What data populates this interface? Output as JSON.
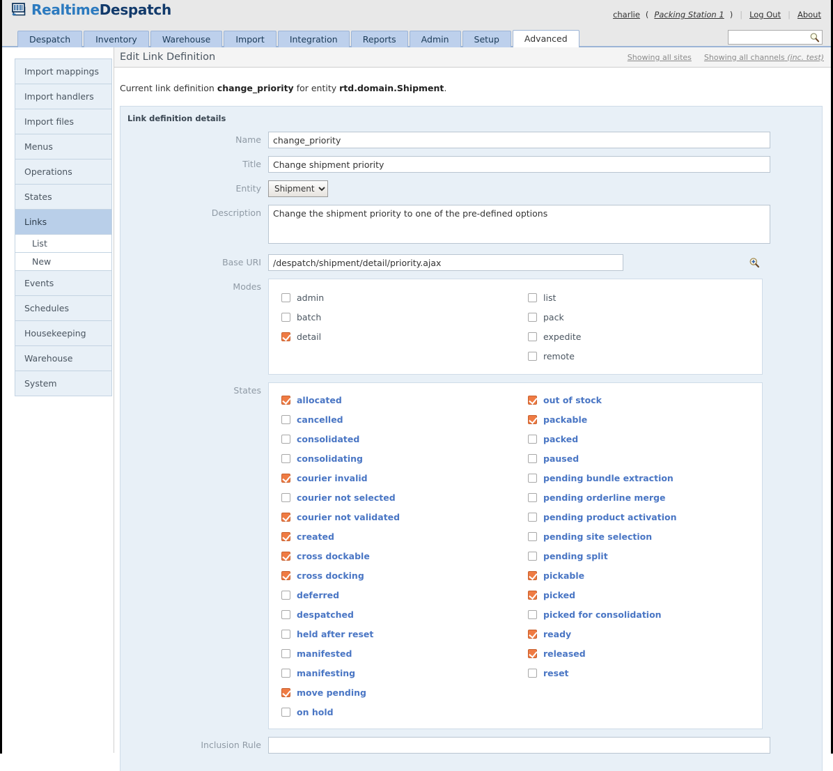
{
  "brand": {
    "part1": "Realtime",
    "part2": "Despatch",
    "logo_icon": "barcode-monitor-icon"
  },
  "header": {
    "user": "charlie",
    "station": "Packing Station 1",
    "logout": "Log Out",
    "about": "About",
    "search_placeholder": "",
    "search_value": "",
    "search_icon": "search-icon"
  },
  "tabs": [
    {
      "label": "Despatch",
      "active": false
    },
    {
      "label": "Inventory",
      "active": false
    },
    {
      "label": "Warehouse",
      "active": false
    },
    {
      "label": "Import",
      "active": false
    },
    {
      "label": "Integration",
      "active": false
    },
    {
      "label": "Reports",
      "active": false
    },
    {
      "label": "Admin",
      "active": false
    },
    {
      "label": "Setup",
      "active": false
    },
    {
      "label": "Advanced",
      "active": true
    }
  ],
  "sidebar": {
    "items": [
      {
        "label": "Import mappings",
        "active": false,
        "sub": false
      },
      {
        "label": "Import handlers",
        "active": false,
        "sub": false
      },
      {
        "label": "Import files",
        "active": false,
        "sub": false
      },
      {
        "label": "Menus",
        "active": false,
        "sub": false
      },
      {
        "label": "Operations",
        "active": false,
        "sub": false
      },
      {
        "label": "States",
        "active": false,
        "sub": false
      },
      {
        "label": "Links",
        "active": true,
        "sub": false
      },
      {
        "label": "List",
        "active": false,
        "sub": true
      },
      {
        "label": "New",
        "active": false,
        "sub": true
      },
      {
        "label": "Events",
        "active": false,
        "sub": false
      },
      {
        "label": "Schedules",
        "active": false,
        "sub": false
      },
      {
        "label": "Housekeeping",
        "active": false,
        "sub": false
      },
      {
        "label": "Warehouse",
        "active": false,
        "sub": false
      },
      {
        "label": "System",
        "active": false,
        "sub": false
      }
    ]
  },
  "content": {
    "title": "Edit Link Definition",
    "showing_sites": "Showing all sites",
    "showing_channels": "Showing all channels",
    "showing_channels_note": "(inc. test)",
    "lead_pre": "Current link definition ",
    "lead_name": "change_priority",
    "lead_mid": " for entity ",
    "lead_entity": "rtd.domain.Shipment",
    "lead_post": "."
  },
  "form": {
    "panel_title": "Link definition details",
    "labels": {
      "name": "Name",
      "title": "Title",
      "entity": "Entity",
      "description": "Description",
      "base_uri": "Base URI",
      "modes": "Modes",
      "states": "States",
      "inclusion_rule": "Inclusion Rule"
    },
    "values": {
      "name": "change_priority",
      "title": "Change shipment priority",
      "entity": "Shipment",
      "entity_options": [
        "Shipment"
      ],
      "description": "Change the shipment priority to one of the pre-defined options",
      "base_uri": "/despatch/shipment/detail/priority.ajax",
      "inclusion_rule": ""
    },
    "magnifier_icon": "zoom-in-icon",
    "modes": {
      "left": [
        {
          "label": "admin",
          "checked": false
        },
        {
          "label": "batch",
          "checked": false
        },
        {
          "label": "detail",
          "checked": true
        }
      ],
      "right": [
        {
          "label": "list",
          "checked": false
        },
        {
          "label": "pack",
          "checked": false
        },
        {
          "label": "expedite",
          "checked": false
        },
        {
          "label": "remote",
          "checked": false
        }
      ]
    },
    "states": {
      "left": [
        {
          "label": "allocated",
          "checked": true
        },
        {
          "label": "cancelled",
          "checked": false
        },
        {
          "label": "consolidated",
          "checked": false
        },
        {
          "label": "consolidating",
          "checked": false
        },
        {
          "label": "courier invalid",
          "checked": true
        },
        {
          "label": "courier not selected",
          "checked": false
        },
        {
          "label": "courier not validated",
          "checked": true
        },
        {
          "label": "created",
          "checked": true
        },
        {
          "label": "cross dockable",
          "checked": true
        },
        {
          "label": "cross docking",
          "checked": true
        },
        {
          "label": "deferred",
          "checked": false
        },
        {
          "label": "despatched",
          "checked": false
        },
        {
          "label": "held after reset",
          "checked": false
        },
        {
          "label": "manifested",
          "checked": false
        },
        {
          "label": "manifesting",
          "checked": false
        },
        {
          "label": "move pending",
          "checked": true
        },
        {
          "label": "on hold",
          "checked": false
        }
      ],
      "right": [
        {
          "label": "out of stock",
          "checked": true
        },
        {
          "label": "packable",
          "checked": true
        },
        {
          "label": "packed",
          "checked": false
        },
        {
          "label": "paused",
          "checked": false
        },
        {
          "label": "pending bundle extraction",
          "checked": false
        },
        {
          "label": "pending orderline merge",
          "checked": false
        },
        {
          "label": "pending product activation",
          "checked": false
        },
        {
          "label": "pending site selection",
          "checked": false
        },
        {
          "label": "pending split",
          "checked": false
        },
        {
          "label": "pickable",
          "checked": true
        },
        {
          "label": "picked",
          "checked": true
        },
        {
          "label": "picked for consolidation",
          "checked": false
        },
        {
          "label": "ready",
          "checked": true
        },
        {
          "label": "released",
          "checked": true
        },
        {
          "label": "reset",
          "checked": false
        }
      ]
    }
  },
  "colors": {
    "brand_light": "#2c7abf",
    "brand_dark": "#123a6b",
    "tab_bg": "#bdd0ec",
    "panel_bg": "#e8f0f7",
    "checkbox_on": "#ef7b43",
    "state_label": "#4a76c4",
    "sidebar_active": "#b9cfe9"
  }
}
